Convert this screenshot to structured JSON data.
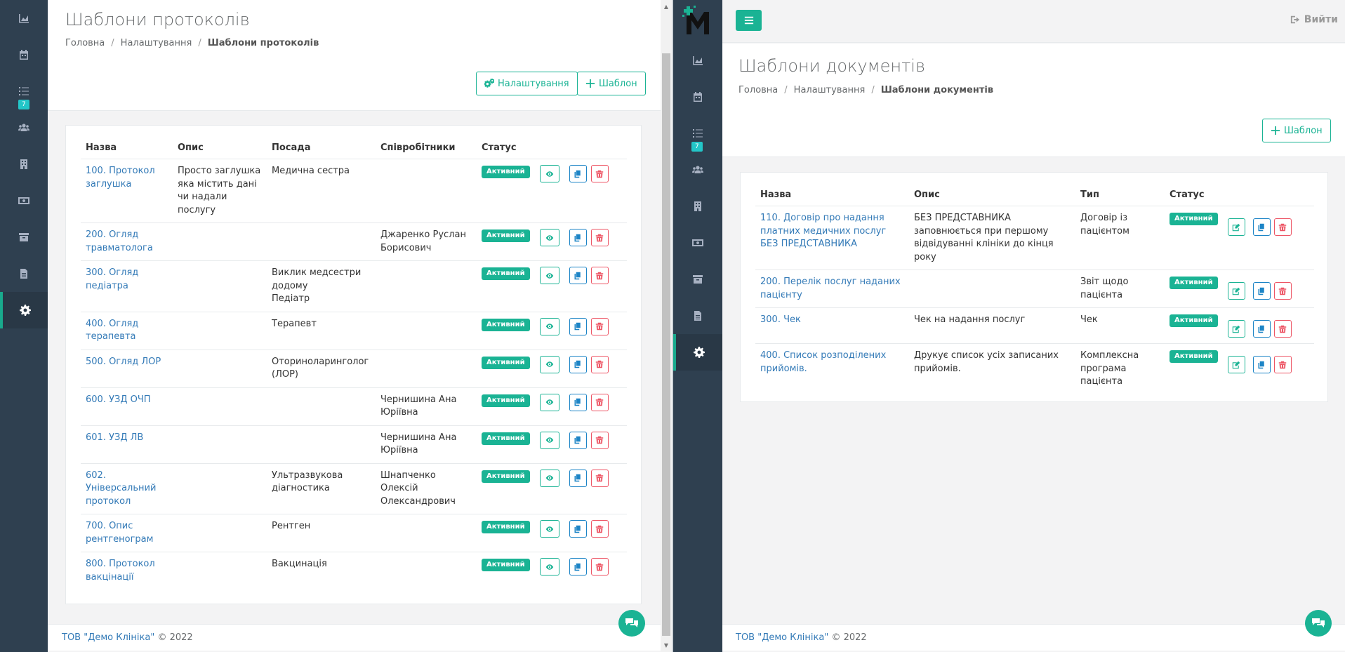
{
  "left": {
    "sidebar": {
      "badge": "7"
    },
    "page_title": "Шаблони протоколів",
    "breadcrumb": {
      "home": "Головна",
      "settings": "Налаштування",
      "current": "Шаблони протоколів"
    },
    "buttons": {
      "settings": "Налаштування",
      "template": "Шаблон"
    },
    "table": {
      "headers": {
        "name": "Назва",
        "desc": "Опис",
        "position": "Посада",
        "employees": "Співробітники",
        "status": "Статус"
      },
      "rows": [
        {
          "name": "100. Протокол заглушка",
          "desc": "Просто заглушка яка містить дані чи надали послугу",
          "position": "Медична сестра",
          "employees": "",
          "status": "Активний"
        },
        {
          "name": "200. Огляд травматолога",
          "desc": "",
          "position": "",
          "employees": "Джаренко Руслан Борисович",
          "status": "Активний"
        },
        {
          "name": "300. Огляд педіатра",
          "desc": "",
          "position": "Виклик медсестри додому\nПедіатр",
          "employees": "",
          "status": "Активний"
        },
        {
          "name": "400. Огляд терапевта",
          "desc": "",
          "position": "Терапевт",
          "employees": "",
          "status": "Активний"
        },
        {
          "name": "500. Огляд ЛОР",
          "desc": "",
          "position": "Оториноларинголог (ЛОР)",
          "employees": "",
          "status": "Активний"
        },
        {
          "name": "600. УЗД ОЧП",
          "desc": "",
          "position": "",
          "employees": "Чернишина Ана Юріївна",
          "status": "Активний"
        },
        {
          "name": "601. УЗД ЛВ",
          "desc": "",
          "position": "",
          "employees": "Чернишина Ана Юріївна",
          "status": "Активний"
        },
        {
          "name": "602. Універсальний протокол",
          "desc": "",
          "position": "Ультразвукова діагностика",
          "employees": "Шнапченко Олексій Олександрович",
          "status": "Активний"
        },
        {
          "name": "700. Опис рентгенограм",
          "desc": "",
          "position": "Рентген",
          "employees": "",
          "status": "Активний"
        },
        {
          "name": "800. Протокол вакцінації",
          "desc": "",
          "position": "Вакцинація",
          "employees": "",
          "status": "Активний"
        }
      ]
    },
    "footer": {
      "company": "ТОВ \"Демо Клініка\"",
      "copyright": "© 2022"
    }
  },
  "right": {
    "sidebar": {
      "badge": "7",
      "logo": "M"
    },
    "topbar": {
      "logout": "Вийти"
    },
    "page_title": "Шаблони документів",
    "breadcrumb": {
      "home": "Головна",
      "settings": "Налаштування",
      "current": "Шаблони документів"
    },
    "buttons": {
      "template": "Шаблон"
    },
    "table": {
      "headers": {
        "name": "Назва",
        "desc": "Опис",
        "type": "Тип",
        "status": "Статус"
      },
      "rows": [
        {
          "name": "110. Договір про надання платних медичних послуг БЕЗ ПРЕДСТАВНИКА",
          "desc": "БЕЗ ПРЕДСТАВНИКА заповнюється при першому відвідуванні клініки до кінця року",
          "type": "Договір із пацієнтом",
          "status": "Активний"
        },
        {
          "name": "200. Перелік послуг наданих пацієнту",
          "desc": "",
          "type": "Звіт щодо пацієнта",
          "status": "Активний"
        },
        {
          "name": "300. Чек",
          "desc": "Чек на надання послуг",
          "type": "Чек",
          "status": "Активний"
        },
        {
          "name": "400. Список розподілених прийомів.",
          "desc": "Друкує список усіх записаних прийомів.",
          "type": "Комплексна програма пацієнта",
          "status": "Активний"
        }
      ]
    },
    "footer": {
      "company": "ТОВ \"Демо Клініка\"",
      "copyright": "© 2022"
    }
  }
}
